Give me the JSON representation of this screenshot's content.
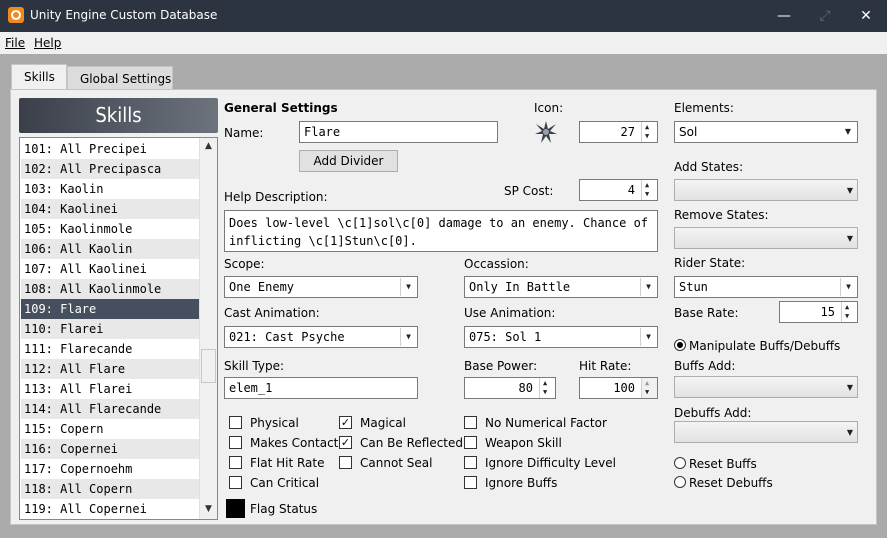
{
  "window": {
    "title": "Unity Engine Custom Database",
    "minimize": "—",
    "maximize": "⤢",
    "close": "✕"
  },
  "menu": {
    "file": "File",
    "help": "Help"
  },
  "tabs": [
    "Skills",
    "Global Settings"
  ],
  "list": {
    "header": "Skills",
    "items": [
      "101: All Precipei",
      "102: All Precipasca",
      "103: Kaolin",
      "104: Kaolinei",
      "105: Kaolinmole",
      "106: All Kaolin",
      "107: All Kaolinei",
      "108: All Kaolinmole",
      "109: Flare",
      "110: Flarei",
      "111: Flarecande",
      "112: All Flare",
      "113: All Flarei",
      "114: All Flarecande",
      "115: Copern",
      "116: Copernei",
      "117: Copernoehm",
      "118: All Copern",
      "119: All Copernei"
    ],
    "selected_index": 8
  },
  "general": {
    "heading": "General Settings",
    "name_label": "Name:",
    "name_value": "Flare",
    "add_divider": "Add Divider",
    "icon_label": "Icon:",
    "icon_value": "27",
    "sp_label": "SP Cost:",
    "sp_value": "4",
    "help_label": "Help Description:",
    "help_line1": "Does low-level \\c[1]sol\\c[0] damage to an enemy. Chance of",
    "help_line2": "inflicting \\c[1]Stun\\c[0].",
    "scope_label": "Scope:",
    "scope_value": "One Enemy",
    "occasion_label": "Occassion:",
    "occasion_value": "Only In Battle",
    "cast_label": "Cast Animation:",
    "cast_value": "021: Cast Psyche",
    "use_label": "Use Animation:",
    "use_value": "075: Sol 1",
    "type_label": "Skill Type:",
    "type_value": "elem_1",
    "power_label": "Base Power:",
    "power_value": "80",
    "hit_label": "Hit Rate:",
    "hit_value": "100"
  },
  "flags": {
    "physical": "Physical",
    "makes_contact": "Makes Contact",
    "flat_hit": "Flat Hit Rate",
    "can_critical": "Can Critical",
    "magical": "Magical",
    "reflected": "Can Be Reflected",
    "cannot_seal": "Cannot Seal",
    "no_numerical": "No Numerical Factor",
    "weapon_skill": "Weapon Skill",
    "ignore_difficulty": "Ignore Difficulty Level",
    "ignore_buffs": "Ignore Buffs",
    "flag_status": "Flag Status",
    "check_mark": "✓"
  },
  "right": {
    "elements_label": "Elements:",
    "elements_value": "Sol",
    "add_states_label": "Add States:",
    "remove_states_label": "Remove States:",
    "rider_label": "Rider State:",
    "rider_value": "Stun",
    "base_rate_label": "Base Rate:",
    "base_rate_value": "15",
    "manipulate": "Manipulate Buffs/Debuffs",
    "buffs_add_label": "Buffs Add:",
    "debuffs_add_label": "Debuffs Add:",
    "reset_buffs": "Reset Buffs",
    "reset_debuffs": "Reset Debuffs"
  },
  "colors": {
    "titlebar": "#2b3440",
    "selection": "#464f5e",
    "accent": "#f08a1c"
  }
}
